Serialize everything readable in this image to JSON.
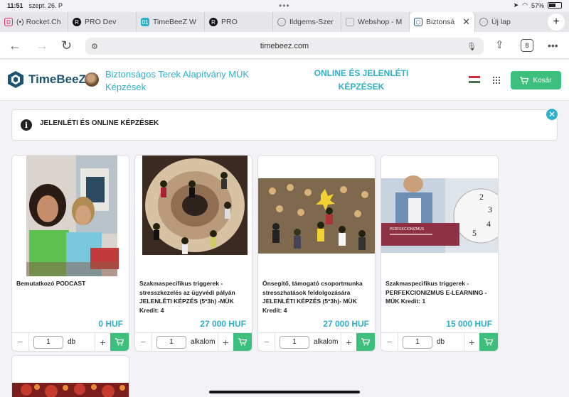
{
  "status": {
    "time": "11:51",
    "date": "szept. 26. P",
    "battery": "57%"
  },
  "tabs": [
    {
      "label": "(•) Rocket.Ch",
      "icon": "rocket-chat-icon",
      "color": "#e0245e"
    },
    {
      "label": "PRO Dev",
      "icon": "r-logo-icon",
      "color": "#111111"
    },
    {
      "label": "TimeBeeZ W",
      "icon": "timebeez-icon",
      "color": "#2fb0c9"
    },
    {
      "label": "PRO",
      "icon": "r-logo-icon",
      "color": "#111111"
    },
    {
      "label": "Ildgems-Szer",
      "icon": "globe-icon",
      "color": "#888888"
    },
    {
      "label": "Webshop - M",
      "icon": "page-icon",
      "color": "#888888"
    },
    {
      "label": "Biztonsá",
      "icon": "timebeez-icon",
      "color": "#1e5470"
    },
    {
      "label": "Új lap",
      "icon": "globe-icon",
      "color": "#888888"
    }
  ],
  "browser": {
    "url": "timebeez.com",
    "tab_count": "8"
  },
  "site": {
    "logo_text": "TimeBeeZ",
    "org_name": "Biztonságos Terek Alapítvány MÜK Képzések",
    "headline": "ONLINE ÉS JELENLÉTI KÉPZÉSEK",
    "cart_label": "Kosár"
  },
  "info": {
    "text": "JELENLÉTI ÉS ONLINE KÉPZÉSEK"
  },
  "products": [
    {
      "title": "Bemutatkozó PODCAST",
      "price": "0 HUF",
      "qty": "1",
      "unit": "db"
    },
    {
      "title": "Szakmaspecifikus triggerek - stresszkezelés az ügyvédi pályán JELENLÉTI KÉPZÉS (5*3h) -MÜK Kredit: 4",
      "price": "27 000 HUF",
      "qty": "1",
      "unit": "alkalom"
    },
    {
      "title": "Önsegítő, támogató csoportmunka stresszhatások feldolgozására JELENLÉTI KÉPZÉS (5*3h)- MÜK Kredit: 4",
      "price": "27 000 HUF",
      "qty": "1",
      "unit": "alkalom"
    },
    {
      "title": "Szakmaspecifikus triggerek - PERFEKCIONIZMUS E-LEARNING - MÜK Kredit: 1",
      "price": "15 000 HUF",
      "qty": "1",
      "unit": "db"
    }
  ],
  "product4_image_text": "PERFEKCIONIZMUS",
  "colors": {
    "accent": "#2fb0c9",
    "brand": "#1e5470",
    "green": "#3dbf7d"
  }
}
